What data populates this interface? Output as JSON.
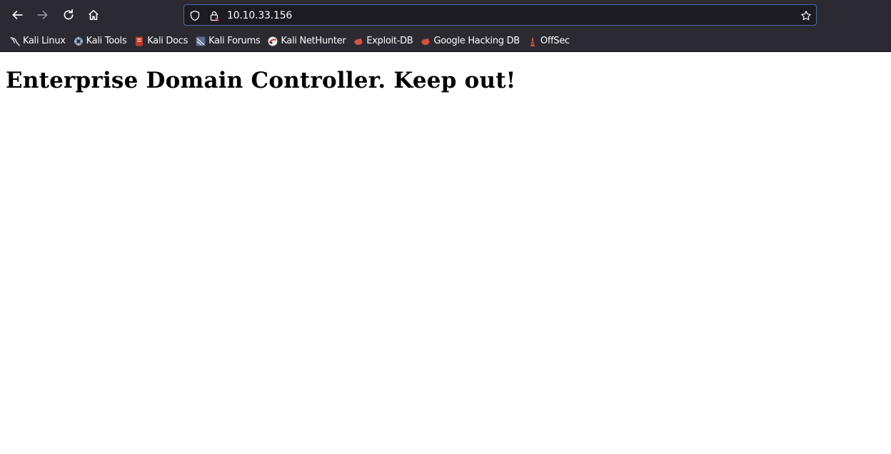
{
  "browser": {
    "nav": {
      "back_icon": "arrow-left-icon",
      "forward_icon": "arrow-right-icon",
      "reload_icon": "reload-icon",
      "home_icon": "home-icon"
    },
    "url_bar": {
      "url": "10.10.33.156",
      "tracking_icon": "shield-icon",
      "security_icon": "lock-warning-icon",
      "bookmark_icon": "star-icon"
    },
    "bookmarks": [
      {
        "label": "Kali Linux",
        "icon": "kali-dragon-icon"
      },
      {
        "label": "Kali Tools",
        "icon": "kali-tools-icon"
      },
      {
        "label": "Kali Docs",
        "icon": "kali-docs-icon"
      },
      {
        "label": "Kali Forums",
        "icon": "kali-forums-icon"
      },
      {
        "label": "Kali NetHunter",
        "icon": "nethunter-icon"
      },
      {
        "label": "Exploit-DB",
        "icon": "exploit-db-icon"
      },
      {
        "label": "Google Hacking DB",
        "icon": "ghdb-icon"
      },
      {
        "label": "OffSec",
        "icon": "offsec-icon"
      }
    ],
    "colors": {
      "chrome_bg": "#2b2a33",
      "url_bg": "#1c1b22",
      "url_border": "#4a6aa8",
      "text": "#fbfbfe"
    }
  },
  "page": {
    "heading": "Enterprise Domain Controller. Keep out!"
  }
}
